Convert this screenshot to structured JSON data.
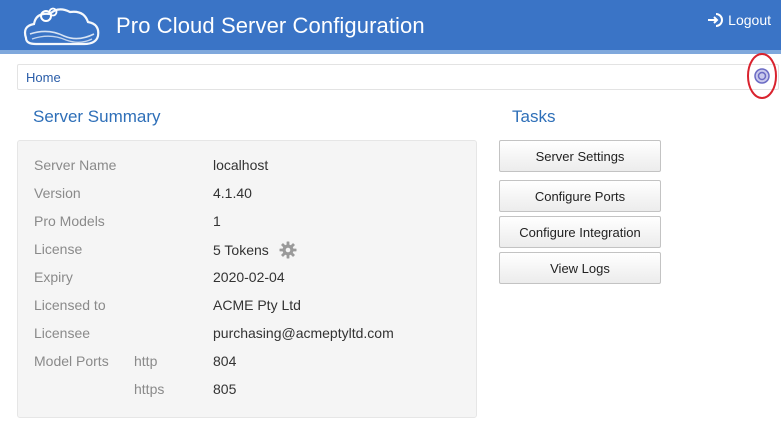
{
  "header": {
    "title": "Pro Cloud Server Configuration",
    "logout_label": "Logout",
    "background": "#3a74c6"
  },
  "breadcrumb": {
    "home_label": "Home"
  },
  "summary": {
    "title": "Server Summary",
    "rows": [
      {
        "label": "Server Name",
        "value": "localhost"
      },
      {
        "label": "Version",
        "value": "4.1.40"
      },
      {
        "label": "Pro Models",
        "value": "1"
      },
      {
        "label": "License",
        "value": "5 Tokens",
        "icon": "gear-icon"
      },
      {
        "label": "Expiry",
        "value": "2020-02-04"
      },
      {
        "label": "Licensed to",
        "value": "ACME Pty Ltd"
      },
      {
        "label": "Licensee",
        "value": "purchasing@acmeptyltd.com"
      },
      {
        "label": "Model Ports",
        "sublabel": "http",
        "value": "804"
      },
      {
        "label": "",
        "sublabel": "https",
        "value": "805"
      }
    ]
  },
  "tasks": {
    "title": "Tasks",
    "buttons": [
      "Server Settings",
      "Configure Ports",
      "Configure Integration",
      "View Logs"
    ]
  },
  "icons": {
    "logo": "cloud-logo-icon",
    "logout": "logout-icon",
    "help": "help-icon",
    "license": "gear-icon"
  },
  "colors": {
    "accent": "#2e6fb8",
    "highlight_circle": "#d9232e"
  }
}
